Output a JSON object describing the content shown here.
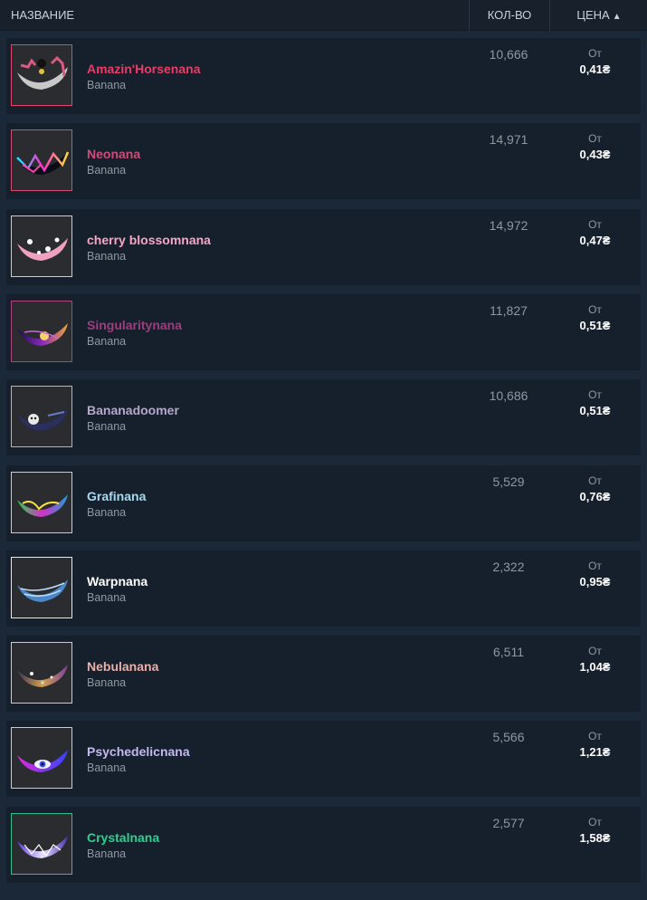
{
  "header": {
    "name": "НАЗВАНИЕ",
    "qty": "КОЛ-ВО",
    "price": "ЦЕНА",
    "sort_arrow": "▲"
  },
  "rows": [
    {
      "name": "Amazin'Horsenana",
      "game": "Banana",
      "qty": "10,666",
      "from": "От",
      "price": "0,41₴",
      "name_color": "#ec3b66",
      "border": "#e0456e",
      "icon": "horse-banana-icon"
    },
    {
      "name": "Neonana",
      "game": "Banana",
      "qty": "14,971",
      "from": "От",
      "price": "0,43₴",
      "name_color": "#cf4b77",
      "border": "#d05070",
      "icon": "neon-banana-icon"
    },
    {
      "name": "cherry blossomnana",
      "game": "Banana",
      "qty": "14,972",
      "from": "От",
      "price": "0,47₴",
      "name_color": "#f7a6c3",
      "border": "#c9cdd2",
      "icon": "cherry-blossom-banana-icon"
    },
    {
      "name": "Singularitynana",
      "game": "Banana",
      "qty": "11,827",
      "from": "От",
      "price": "0,51₴",
      "name_color": "#a03c7e",
      "border": "#b04480",
      "icon": "singularity-banana-icon"
    },
    {
      "name": "Bananadoomer",
      "game": "Banana",
      "qty": "10,686",
      "from": "От",
      "price": "0,51₴",
      "name_color": "#b7a7cc",
      "border": "#b5b5b5",
      "icon": "doomer-banana-icon"
    },
    {
      "name": "Grafinana",
      "game": "Banana",
      "qty": "5,529",
      "from": "От",
      "price": "0,76₴",
      "name_color": "#a8d8ee",
      "border": "#c9cdd2",
      "icon": "graffiti-banana-icon"
    },
    {
      "name": "Warpnana",
      "game": "Banana",
      "qty": "2,322",
      "from": "От",
      "price": "0,95₴",
      "name_color": "#ffffff",
      "border": "#e8e8e8",
      "icon": "warp-banana-icon"
    },
    {
      "name": "Nebulanana",
      "game": "Banana",
      "qty": "6,511",
      "from": "От",
      "price": "1,04₴",
      "name_color": "#e8b0a8",
      "border": "#c9cdd2",
      "icon": "nebula-banana-icon"
    },
    {
      "name": "Psychedelicnana",
      "game": "Banana",
      "qty": "5,566",
      "from": "От",
      "price": "1,21₴",
      "name_color": "#c4b8ee",
      "border": "#c9cdd2",
      "icon": "psychedelic-banana-icon"
    },
    {
      "name": "Crystalnana",
      "game": "Banana",
      "qty": "2,577",
      "from": "От",
      "price": "1,58₴",
      "name_color": "#2ccf8e",
      "border": "#2ec08a",
      "icon": "crystal-banana-icon"
    }
  ]
}
